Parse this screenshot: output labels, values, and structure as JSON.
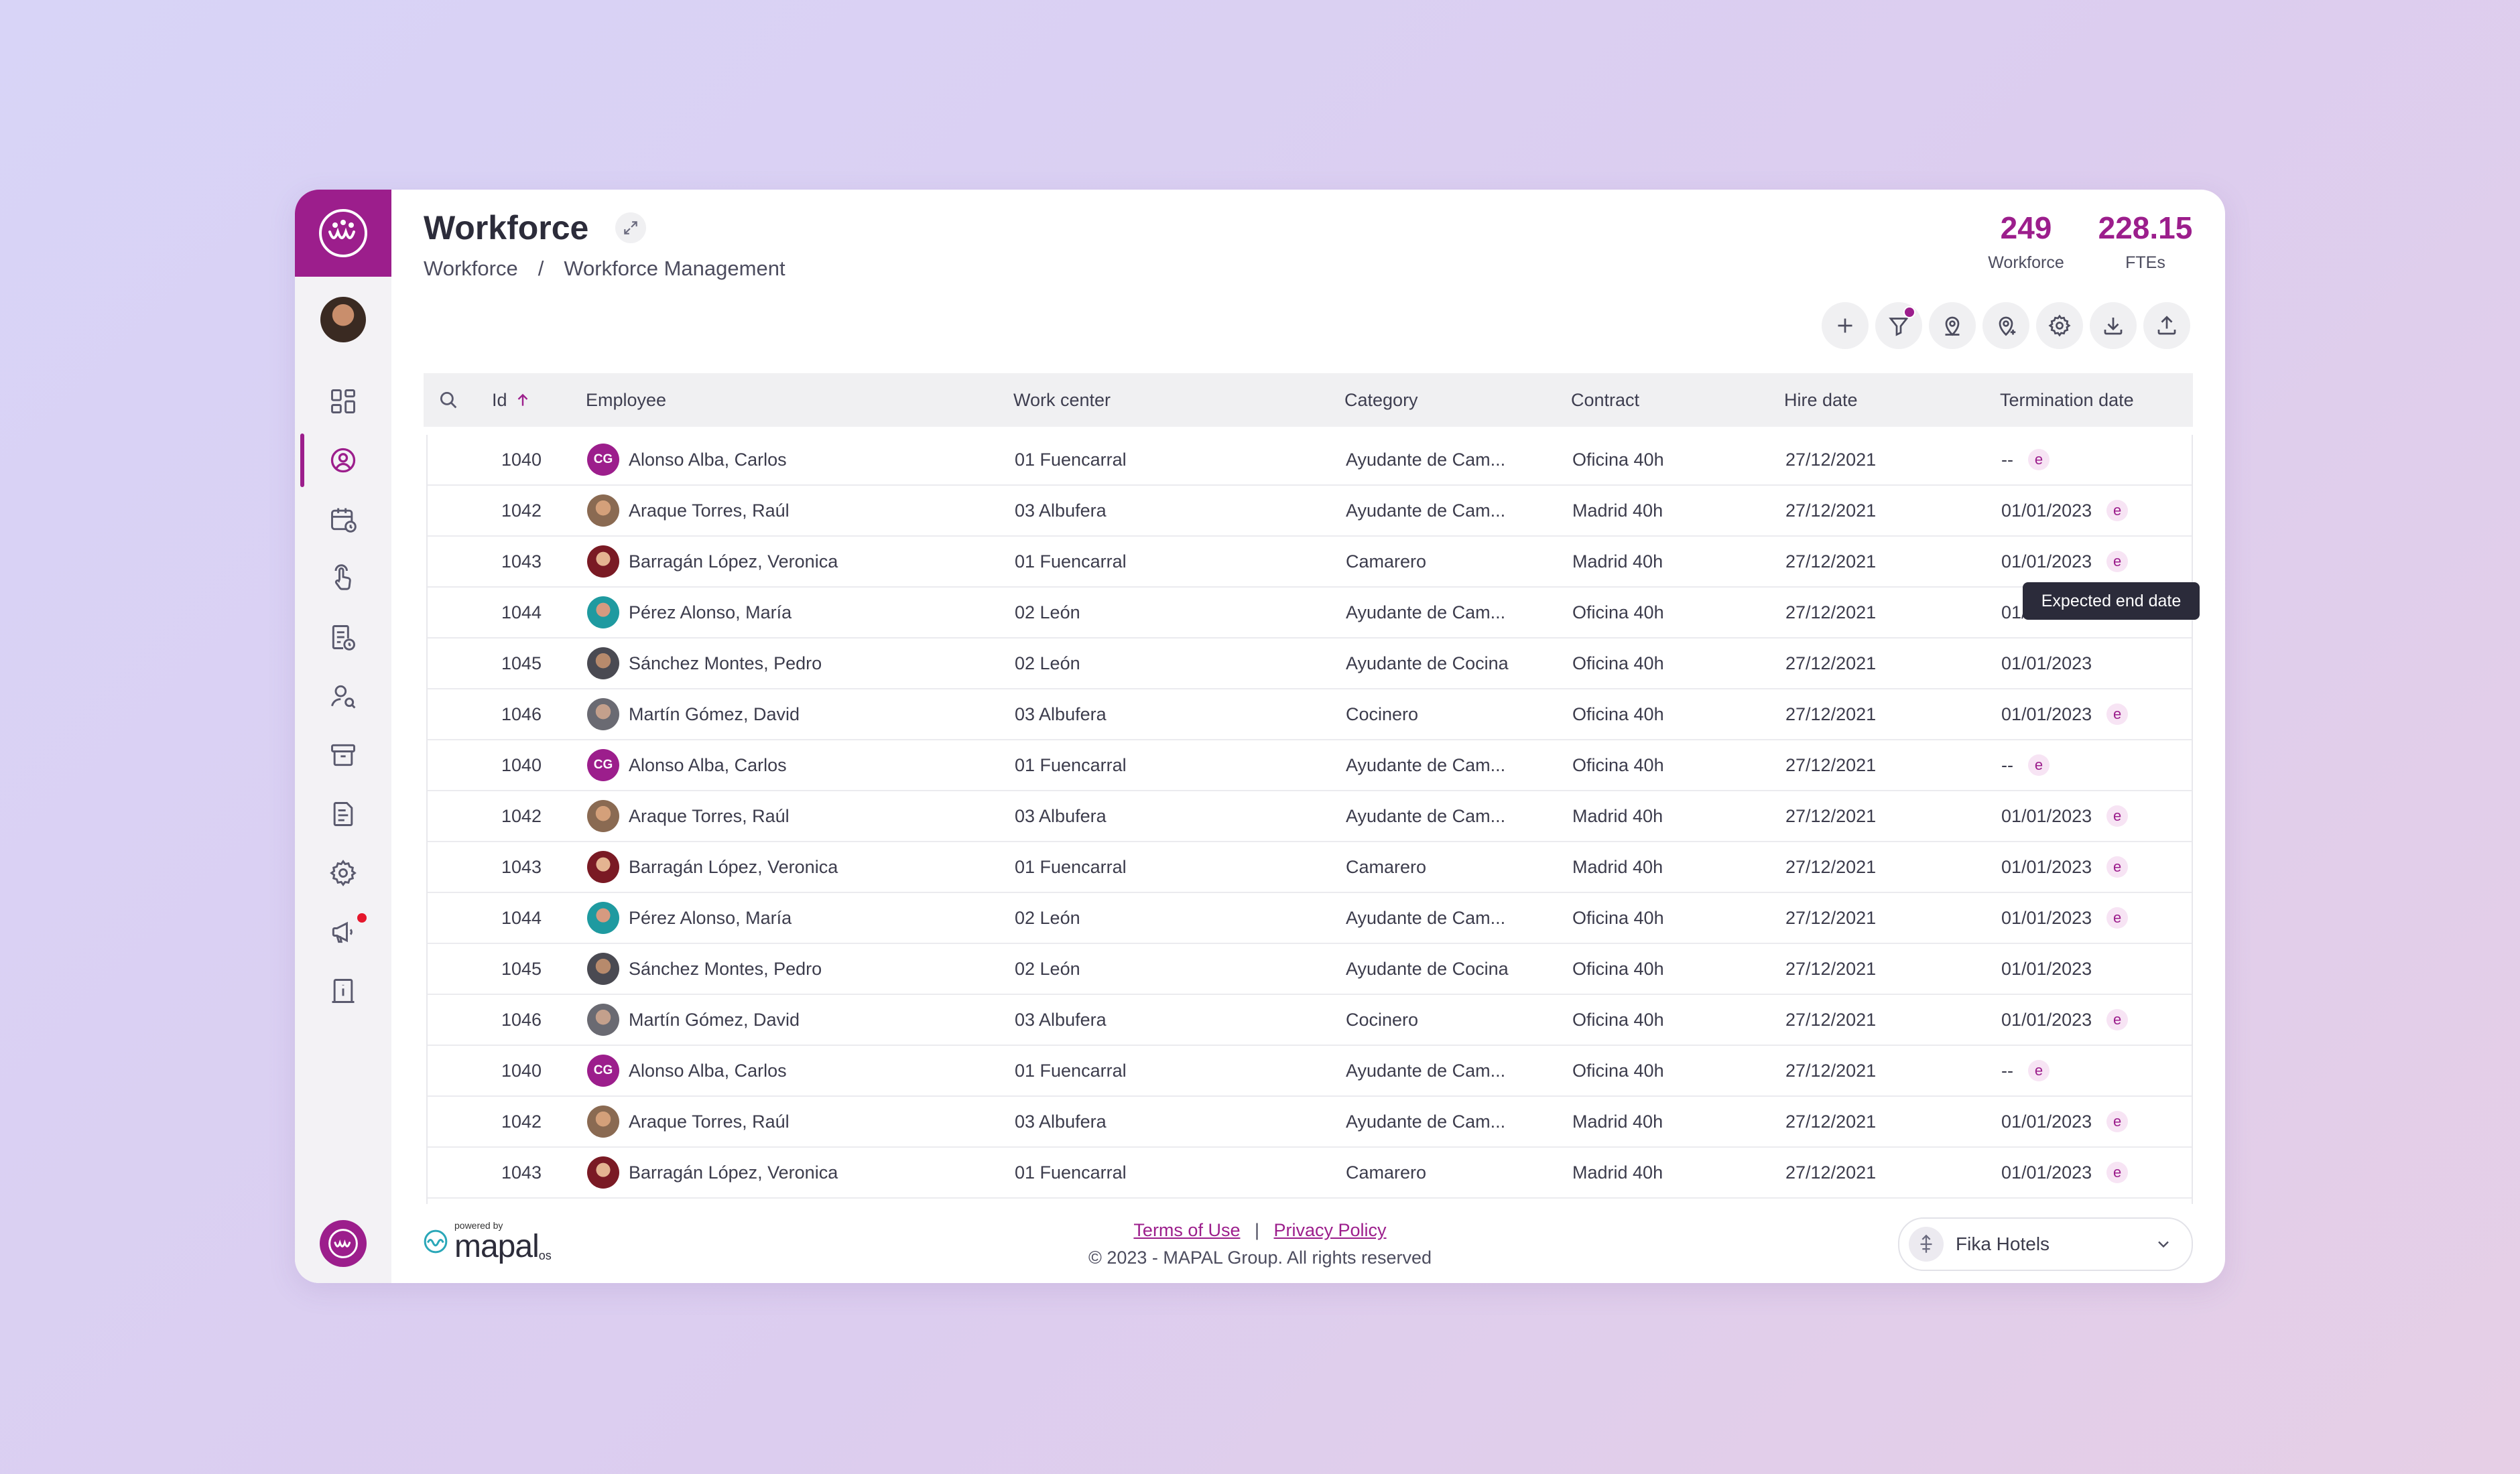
{
  "header": {
    "title": "Workforce",
    "breadcrumb": {
      "root": "Workforce",
      "separator": "/",
      "current": "Workforce Management"
    },
    "stats": [
      {
        "value": "249",
        "label": "Workforce"
      },
      {
        "value": "228.15",
        "label": "FTEs"
      }
    ]
  },
  "sidebar": {
    "items": [
      {
        "icon": "dashboard-icon"
      },
      {
        "icon": "user-profile-icon",
        "active": true
      },
      {
        "icon": "calendar-icon"
      },
      {
        "icon": "touch-hand-icon"
      },
      {
        "icon": "document-clock-icon"
      },
      {
        "icon": "user-search-icon"
      },
      {
        "icon": "archive-icon"
      },
      {
        "icon": "report-icon"
      },
      {
        "icon": "settings-icon"
      },
      {
        "icon": "megaphone-icon",
        "notification": true
      },
      {
        "icon": "info-book-icon"
      }
    ]
  },
  "toolbar": {
    "tools": [
      "add-icon",
      "filter-icon",
      "location-icon",
      "location-add-icon",
      "settings-icon",
      "download-icon",
      "upload-icon"
    ]
  },
  "table": {
    "columns": [
      "Id",
      "Employee",
      "Work center",
      "Category",
      "Contract",
      "Hire date",
      "Termination date"
    ],
    "sort": {
      "column": "Id",
      "direction": "asc"
    },
    "rows": [
      {
        "id": "1040",
        "employee": "Alonso Alba, Carlos",
        "initials": "CG",
        "work_center": "01 Fuencarral",
        "category": "Ayudante de  Cam...",
        "contract": "Oficina 40h",
        "hire_date": "27/12/2021",
        "termination": "--",
        "badge": "e"
      },
      {
        "id": "1042",
        "employee": "Araque Torres, Raúl",
        "initials": "",
        "work_center": "03 Albufera",
        "category": "Ayudante de  Cam...",
        "contract": "Madrid 40h",
        "hire_date": "27/12/2021",
        "termination": "01/01/2023",
        "badge": "e"
      },
      {
        "id": "1043",
        "employee": "Barragán López, Veronica",
        "initials": "",
        "work_center": "01 Fuencarral",
        "category": "Camarero",
        "contract": "Madrid 40h",
        "hire_date": "27/12/2021",
        "termination": "01/01/2023",
        "badge": "e"
      },
      {
        "id": "1044",
        "employee": "Pérez Alonso, María",
        "initials": "",
        "work_center": "02 León",
        "category": "Ayudante de  Cam...",
        "contract": "Oficina 40h",
        "hire_date": "27/12/2021",
        "termination": "01/01/2023",
        "badge": ""
      },
      {
        "id": "1045",
        "employee": "Sánchez Montes, Pedro",
        "initials": "",
        "work_center": "02 León",
        "category": "Ayudante de Cocina",
        "contract": "Oficina 40h",
        "hire_date": "27/12/2021",
        "termination": "01/01/2023",
        "badge": ""
      },
      {
        "id": "1046",
        "employee": "Martín Gómez, David",
        "initials": "",
        "work_center": "03 Albufera",
        "category": "Cocinero",
        "contract": "Oficina 40h",
        "hire_date": "27/12/2021",
        "termination": "01/01/2023",
        "badge": "e"
      },
      {
        "id": "1040",
        "employee": "Alonso Alba, Carlos",
        "initials": "CG",
        "work_center": "01 Fuencarral",
        "category": "Ayudante de  Cam...",
        "contract": "Oficina 40h",
        "hire_date": "27/12/2021",
        "termination": "--",
        "badge": "e"
      },
      {
        "id": "1042",
        "employee": "Araque Torres, Raúl",
        "initials": "",
        "work_center": "03 Albufera",
        "category": "Ayudante de  Cam...",
        "contract": "Madrid 40h",
        "hire_date": "27/12/2021",
        "termination": "01/01/2023",
        "badge": "e"
      },
      {
        "id": "1043",
        "employee": "Barragán López, Veronica",
        "initials": "",
        "work_center": "01 Fuencarral",
        "category": "Camarero",
        "contract": "Madrid 40h",
        "hire_date": "27/12/2021",
        "termination": "01/01/2023",
        "badge": "e"
      },
      {
        "id": "1044",
        "employee": "Pérez Alonso, María",
        "initials": "",
        "work_center": "02 León",
        "category": "Ayudante de  Cam...",
        "contract": "Oficina 40h",
        "hire_date": "27/12/2021",
        "termination": "01/01/2023",
        "badge": "e"
      },
      {
        "id": "1045",
        "employee": "Sánchez Montes, Pedro",
        "initials": "",
        "work_center": "02 León",
        "category": "Ayudante de Cocina",
        "contract": "Oficina 40h",
        "hire_date": "27/12/2021",
        "termination": "01/01/2023",
        "badge": ""
      },
      {
        "id": "1046",
        "employee": "Martín Gómez, David",
        "initials": "",
        "work_center": "03 Albufera",
        "category": "Cocinero",
        "contract": "Oficina 40h",
        "hire_date": "27/12/2021",
        "termination": "01/01/2023",
        "badge": "e"
      },
      {
        "id": "1040",
        "employee": "Alonso Alba, Carlos",
        "initials": "CG",
        "work_center": "01 Fuencarral",
        "category": "Ayudante de  Cam...",
        "contract": "Oficina 40h",
        "hire_date": "27/12/2021",
        "termination": "--",
        "badge": "e"
      },
      {
        "id": "1042",
        "employee": "Araque Torres, Raúl",
        "initials": "",
        "work_center": "03 Albufera",
        "category": "Ayudante de  Cam...",
        "contract": "Madrid 40h",
        "hire_date": "27/12/2021",
        "termination": "01/01/2023",
        "badge": "e"
      },
      {
        "id": "1043",
        "employee": "Barragán López, Veronica",
        "initials": "",
        "work_center": "01 Fuencarral",
        "category": "Camarero",
        "contract": "Madrid 40h",
        "hire_date": "27/12/2021",
        "termination": "01/01/2023",
        "badge": "e"
      }
    ]
  },
  "tooltip": {
    "text": "Expected end date"
  },
  "footer": {
    "powered_by": "powered by",
    "brand": "mapal",
    "brand_suffix": "os",
    "terms": "Terms of Use",
    "separator": "|",
    "privacy": "Privacy Policy",
    "copyright": "© 2023 - MAPAL Group. All rights reserved",
    "company": "Fika Hotels"
  },
  "colors": {
    "brand": "#9c1e8c",
    "notification": "#e5172c",
    "tooltip_bg": "#2b2b3a"
  }
}
